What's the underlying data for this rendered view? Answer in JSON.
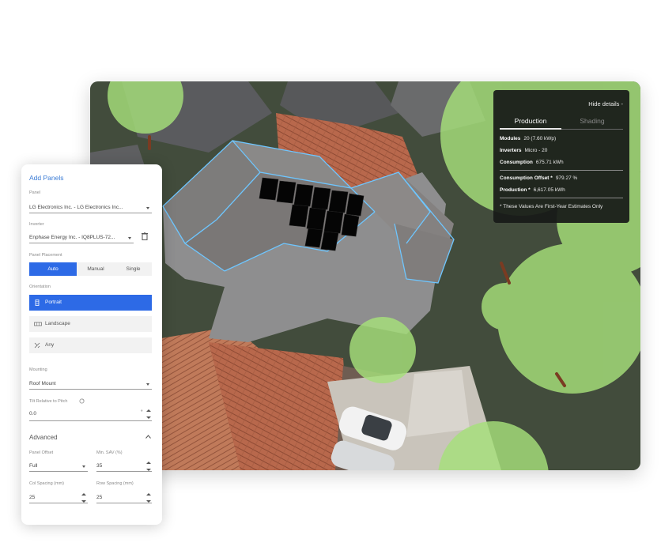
{
  "details": {
    "hide_label": "Hide details -",
    "tabs": [
      "Production",
      "Shading"
    ],
    "modules_label": "Modules",
    "modules_value": "20 (7.60 kWp)",
    "inverters_label": "Inverters",
    "inverters_value": "Micro - 20",
    "consumption_label": "Consumption",
    "consumption_value": "675.71 kWh",
    "offset_label": "Consumption Offset *",
    "offset_value": "979.27 %",
    "production_label": "Production *",
    "production_value": "6,617.05 kWh",
    "note": "* These Values Are First-Year Estimates Only"
  },
  "panel": {
    "title": "Add Panels",
    "panel_label": "Panel",
    "panel_value": "LG Electronics Inc. - LG Electronics Inc...",
    "inverter_label": "Inverter",
    "inverter_value": "Enphase Energy Inc. - IQ8PLUS-72...",
    "placement_label": "Panel Placement",
    "placement_options": [
      "Auto",
      "Manual",
      "Single"
    ],
    "orientation_label": "Orientation",
    "orientation_options": [
      "Portrait",
      "Landscape",
      "Any"
    ],
    "mounting_label": "Mounting",
    "mounting_value": "Roof Mount",
    "tilt_label": "Tilt Relative to Pitch",
    "tilt_value": "0.0",
    "tilt_unit": "°",
    "advanced_label": "Advanced",
    "panel_offset_label": "Panel Offset",
    "panel_offset_value": "Full",
    "min_sav_label": "Min. SAV (%)",
    "min_sav_value": "35",
    "col_spacing_label": "Col Spacing (mm)",
    "col_spacing_value": "25",
    "row_spacing_label": "Row Spacing (mm)",
    "row_spacing_value": "25"
  },
  "colors": {
    "accent": "#2d6ae6",
    "title_blue": "#3a7bd5",
    "tree_green": "#a6e07a",
    "roof_outline": "#6ec6ff",
    "overlay_bg": "#181a18"
  }
}
